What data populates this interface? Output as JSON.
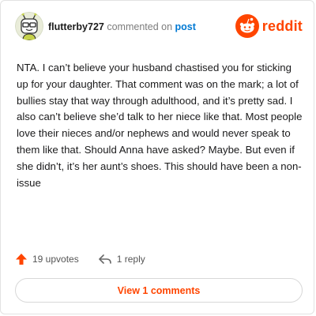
{
  "header": {
    "username": "flutterby727",
    "action_text": "commented on",
    "post_link": "post",
    "brand_name": "reddit"
  },
  "comment": {
    "body": "NTA. I can’t believe your husband chastised you for sticking up for your daughter. That comment was on the mark; a lot of bullies stay that way through adulthood, and it’s pretty sad. I also can’t believe she’d talk to her niece like that. Most people love their nieces and/or nephews and would never speak to them like that. Should Anna have asked? Maybe. But even if she didn’t, it’s her aunt’s shoes. This should have been a non-issue"
  },
  "footer": {
    "upvotes": "19 upvotes",
    "replies": "1 reply"
  },
  "view_comments_label": "View 1 comments",
  "colors": {
    "brand": "#ff4500",
    "link": "#0079d3",
    "text": "#1a1a1b"
  },
  "icons": {
    "avatar": "avatar",
    "brand": "reddit-snoo-icon",
    "upvote": "upvote-arrow-icon",
    "reply": "reply-icon"
  }
}
